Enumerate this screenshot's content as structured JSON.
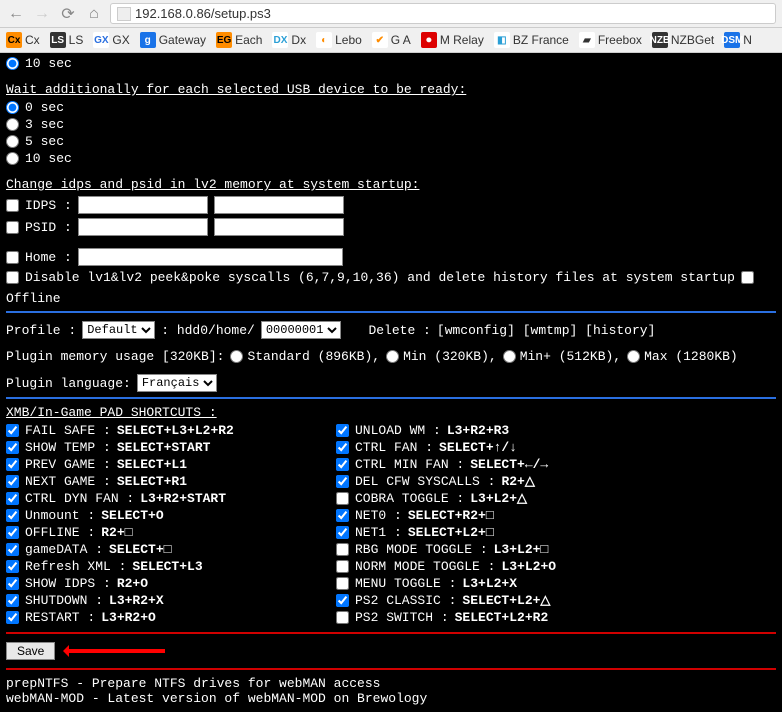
{
  "browser": {
    "url": "192.168.0.86/setup.ps3",
    "bookmarks": [
      {
        "label": "Cx",
        "bg": "#ff8c00",
        "fg": "#000"
      },
      {
        "label": "LS",
        "bg": "#333",
        "fg": "#fff"
      },
      {
        "label": "GX",
        "bg": "#fff",
        "fg": "#2a6fe0"
      },
      {
        "label": "Gateway",
        "bg": "#1a73e8",
        "fg": "#fff",
        "ico": "g"
      },
      {
        "label": "Each",
        "bg": "#ff8c00",
        "fg": "#000",
        "ico": "EG"
      },
      {
        "label": "Dx",
        "bg": "#fff",
        "fg": "#2a9fd6",
        "ico": "DX"
      },
      {
        "label": "Lebo",
        "bg": "#fff",
        "fg": "#ff8c00",
        "ico": "◐"
      },
      {
        "label": "G A",
        "bg": "#fff",
        "fg": "#ff8c00",
        "ico": "✔"
      },
      {
        "label": "M Relay",
        "bg": "#d00",
        "fg": "#fff",
        "ico": "⏺"
      },
      {
        "label": "BZ France",
        "bg": "#fff",
        "fg": "#2a9fd6",
        "ico": "◧"
      },
      {
        "label": "Freebox",
        "bg": "#fff",
        "fg": "#333",
        "ico": "▰"
      },
      {
        "label": "NZBGet",
        "bg": "#333",
        "fg": "#fff",
        "ico": "NZB"
      },
      {
        "label": "N",
        "bg": "#1a73e8",
        "fg": "#fff",
        "ico": "DSM"
      }
    ]
  },
  "trail_radio": "10 sec",
  "usb_wait": {
    "heading": "Wait additionally for each selected USB device to be ready:",
    "options": [
      "0 sec",
      "3 sec",
      "5 sec",
      "10 sec"
    ],
    "selected": 0
  },
  "idps_psid": {
    "heading": "Change idps and psid in lv2 memory at system startup:",
    "idps_label": "IDPS :",
    "psid_label": "PSID :",
    "idps_checked": false,
    "psid_checked": false
  },
  "home": {
    "label": "Home :",
    "checked": false,
    "value": ""
  },
  "syscalls": {
    "label": "Disable lv1&lv2 peek&poke syscalls (6,7,9,10,36) and delete history files at system startup",
    "checked": false,
    "offline_label": "Offline",
    "offline_checked": false
  },
  "profile": {
    "label": "Profile :",
    "profile_value": "Default",
    "path_prefix": ": hdd0/home/",
    "path_value": "00000001",
    "delete_label": "Delete :",
    "links": [
      "wmconfig",
      "wmtmp",
      "history"
    ]
  },
  "memory": {
    "label": "Plugin memory usage [320KB]:",
    "options": [
      "Standard (896KB),",
      "Min (320KB),",
      "Min+ (512KB),",
      "Max (1280KB)"
    ],
    "selected": -1
  },
  "language": {
    "label": "Plugin language:",
    "value": "Français"
  },
  "shortcuts": {
    "heading": "XMB/In-Game PAD SHORTCUTS :",
    "left": [
      {
        "checked": true,
        "label": "FAIL SAFE :",
        "combo": "SELECT+L3+L2+R2"
      },
      {
        "checked": true,
        "label": "SHOW TEMP :",
        "combo": "SELECT+START"
      },
      {
        "checked": true,
        "label": "PREV GAME :",
        "combo": "SELECT+L1"
      },
      {
        "checked": true,
        "label": "NEXT GAME :",
        "combo": "SELECT+R1"
      },
      {
        "checked": true,
        "label": "CTRL DYN FAN :",
        "combo": "L3+R2+START"
      },
      {
        "checked": true,
        "label": "Unmount :",
        "combo": "SELECT+O"
      },
      {
        "checked": true,
        "label": "OFFLINE :",
        "combo": "R2+□"
      },
      {
        "checked": true,
        "label": "gameDATA :",
        "combo": "SELECT+□"
      },
      {
        "checked": true,
        "label": "Refresh XML :",
        "combo": "SELECT+L3"
      },
      {
        "checked": true,
        "label": "SHOW IDPS :",
        "combo": "R2+O"
      },
      {
        "checked": true,
        "label": "SHUTDOWN :",
        "combo": "L3+R2+X"
      },
      {
        "checked": true,
        "label": "RESTART :",
        "combo": "L3+R2+O"
      }
    ],
    "right": [
      {
        "checked": true,
        "label": "UNLOAD WM :",
        "combo": "L3+R2+R3"
      },
      {
        "checked": true,
        "label": "CTRL FAN :",
        "combo": "SELECT+↑/↓"
      },
      {
        "checked": true,
        "label": "CTRL MIN FAN :",
        "combo": "SELECT+←/→"
      },
      {
        "checked": true,
        "label": "DEL CFW SYSCALLS :",
        "combo": "R2+△"
      },
      {
        "checked": false,
        "label": "COBRA TOGGLE :",
        "combo": "L3+L2+△"
      },
      {
        "checked": true,
        "label": "NET0 :",
        "combo": "SELECT+R2+□"
      },
      {
        "checked": true,
        "label": "NET1 :",
        "combo": "SELECT+L2+□"
      },
      {
        "checked": false,
        "label": "RBG MODE TOGGLE :",
        "combo": "L3+L2+□"
      },
      {
        "checked": false,
        "label": "NORM MODE TOGGLE :",
        "combo": "L3+L2+O"
      },
      {
        "checked": false,
        "label": "MENU TOGGLE :",
        "combo": "L3+L2+X"
      },
      {
        "checked": true,
        "label": "PS2 CLASSIC :",
        "combo": "SELECT+L2+△"
      },
      {
        "checked": false,
        "label": "PS2 SWITCH :",
        "combo": "SELECT+L2+R2"
      }
    ]
  },
  "save_label": "Save",
  "footer": {
    "line1": "prepNTFS - Prepare NTFS drives for webMAN access",
    "line2": "webMAN-MOD - Latest version of webMAN-MOD on Brewology"
  }
}
